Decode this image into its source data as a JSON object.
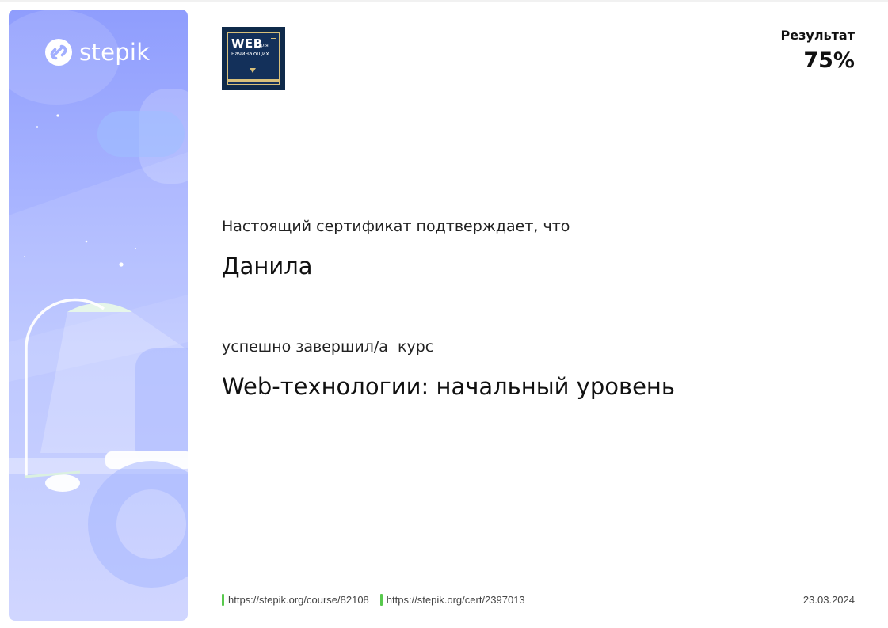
{
  "brand": {
    "name": "stepik",
    "icon": "stepik-logo-icon"
  },
  "course_logo": {
    "title": "WEB",
    "title_small": "для",
    "subtitle": "начинающих",
    "icon": "course-logo-image"
  },
  "result": {
    "label": "Результат",
    "value": "75%"
  },
  "certificate": {
    "confirm_text": "Настоящий сертификат подтверждает, что",
    "student_name": "Данила",
    "completed_text": "успешно завершил/а  курс",
    "course_name": "Web-технологии: начальный уровень"
  },
  "footer": {
    "course_link": "https://stepik.org/course/82108",
    "cert_link": "https://stepik.org/cert/2397013",
    "date": "23.03.2024",
    "link_mark_color": "#58c94d"
  },
  "colors": {
    "panel_gradient_top": "#8f9dfd",
    "panel_gradient_bottom": "#cdd3ff",
    "course_logo_bg": "#0f2a4a",
    "course_logo_accent": "#d8c07a"
  }
}
